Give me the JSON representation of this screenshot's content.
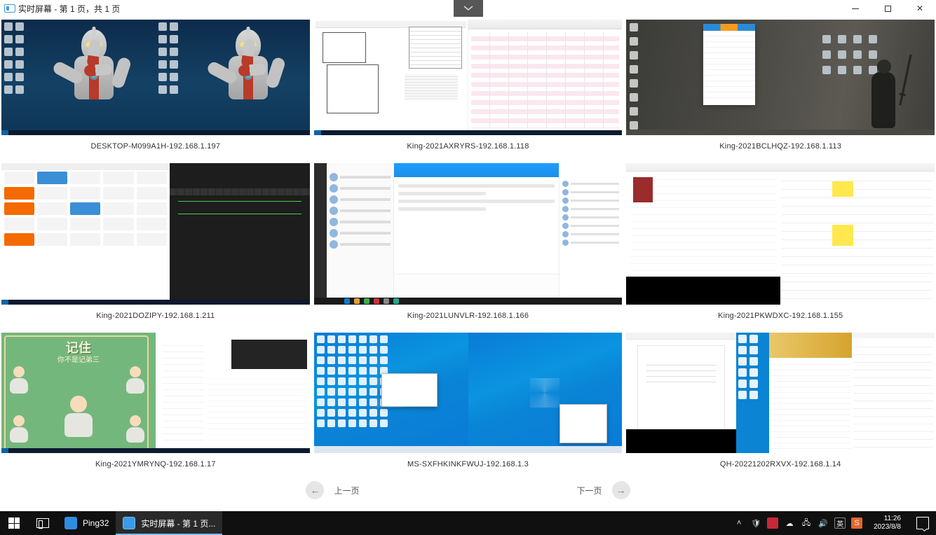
{
  "window": {
    "title": "实时屏幕 - 第 1 页，共 1 页"
  },
  "screens": [
    {
      "label": "DESKTOP-M099A1H-192.168.1.197"
    },
    {
      "label": "King-2021AXRYRS-192.168.1.118"
    },
    {
      "label": "King-2021BCLHQZ-192.168.1.113"
    },
    {
      "label": "King-2021DOZIPY-192.168.1.211"
    },
    {
      "label": "King-2021LUNVLR-192.168.1.166"
    },
    {
      "label": "King-2021PKWDXC-192.168.1.155"
    },
    {
      "label": "King-2021YMRYNQ-192.168.1.17"
    },
    {
      "label": "MS-SXFHKINKFWUJ-192.168.1.3"
    },
    {
      "label": "QH-20221202RXVX-192.168.1.14"
    }
  ],
  "monks_card": {
    "title": "记住",
    "subtitle": "你不是记弟三"
  },
  "pager": {
    "prev": "上一页",
    "next": "下一页"
  },
  "taskbar": {
    "apps": [
      {
        "name": "Ping32",
        "icon_bg": "#2f8de0"
      },
      {
        "name": "实时屏幕 - 第 1 页...",
        "icon_bg": "#3a9ae8"
      }
    ],
    "tray": {
      "ime": "英",
      "sogou": "S"
    },
    "clock": {
      "time": "11:26",
      "date": "2023/8/8"
    }
  }
}
